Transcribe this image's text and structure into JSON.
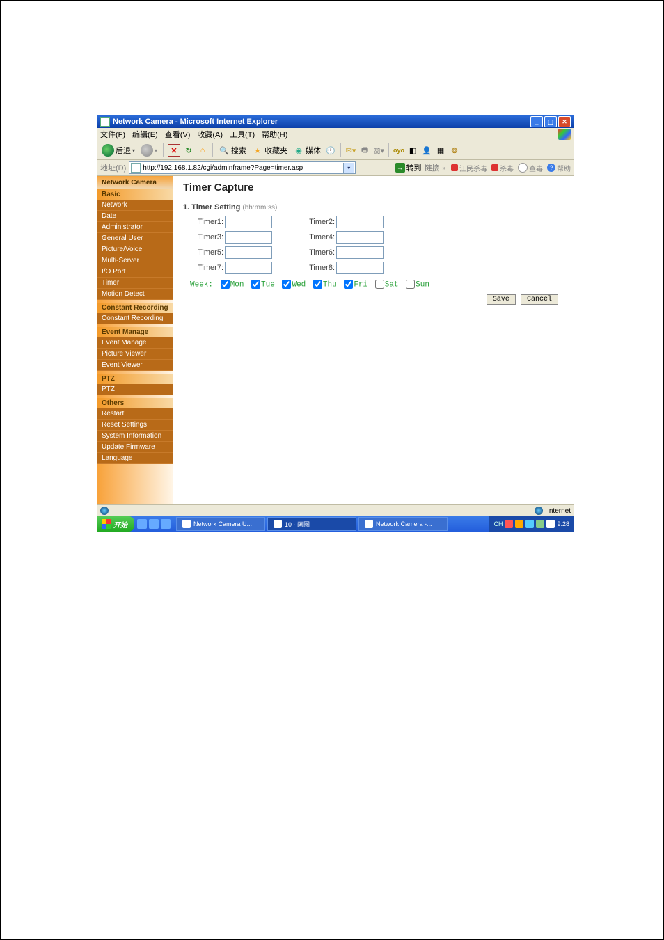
{
  "window": {
    "title": "Network Camera - Microsoft Internet Explorer"
  },
  "menu": {
    "file": "文件(F)",
    "edit": "编辑(E)",
    "view": "查看(V)",
    "fav": "收藏(A)",
    "tools": "工具(T)",
    "help": "帮助(H)"
  },
  "toolbar": {
    "back": "后退",
    "search": "搜索",
    "favorites": "收藏夹",
    "media": "媒体",
    "oyo": "oyo"
  },
  "addressbar": {
    "label": "地址(D)",
    "url": "http://192.168.1.82/cgi/adminframe?Page=timer.asp",
    "go": "转到",
    "links": "链接",
    "jm": "江民杀毒",
    "sd": "杀毒",
    "chk": "查毒",
    "help": "帮助"
  },
  "sidebar": {
    "top": "Network Camera",
    "basic": "Basic",
    "basic_items": [
      "Network",
      "Date",
      "Administrator",
      "General User",
      "Picture/Voice",
      "Multi-Server",
      "I/O Port",
      "Timer",
      "Motion Detect"
    ],
    "cr": "Constant Recording",
    "cr_items": [
      "Constant Recording"
    ],
    "em": "Event Manage",
    "em_items": [
      "Event Manage",
      "Picture Viewer",
      "Event Viewer"
    ],
    "ptz": "PTZ",
    "ptz_items": [
      "PTZ"
    ],
    "others": "Others",
    "others_items": [
      "Restart",
      "Reset Settings",
      "System Information",
      "Update Firmware",
      "Language"
    ]
  },
  "main": {
    "heading": "Timer Capture",
    "section": "1. Timer Setting",
    "hint": "(hh:mm:ss)",
    "timers": {
      "t1": "Timer1:",
      "t2": "Timer2:",
      "t3": "Timer3:",
      "t4": "Timer4:",
      "t5": "Timer5:",
      "t6": "Timer6:",
      "t7": "Timer7:",
      "t8": "Timer8:"
    },
    "week_label": "Week:",
    "days": {
      "mon": "Mon",
      "tue": "Tue",
      "wed": "Wed",
      "thu": "Thu",
      "fri": "Fri",
      "sat": "Sat",
      "sun": "Sun"
    },
    "save": "Save",
    "cancel": "Cancel"
  },
  "statusbar": {
    "done": "",
    "zone": "Internet"
  },
  "taskbar": {
    "start": "开始",
    "task1": "Network Camera U...",
    "task2": "10 - 画图",
    "task3": "Network Camera -...",
    "clock": "9:28"
  }
}
